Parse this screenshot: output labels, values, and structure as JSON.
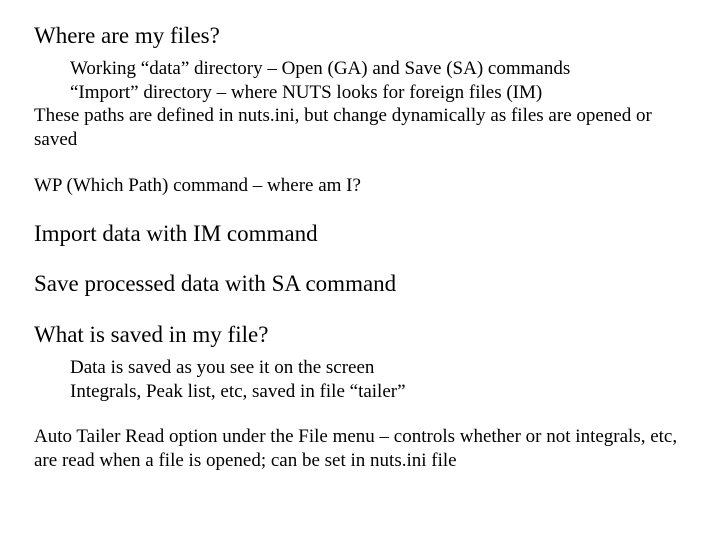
{
  "s1": {
    "heading": "Where are my files?",
    "sub1": "Working “data” directory – Open (GA) and Save (SA)  commands",
    "sub2": "“Import” directory – where NUTS looks for foreign files (IM)",
    "body1": "These paths are defined in nuts.ini, but change dynamically as files are opened or saved",
    "body2": "WP (Which Path) command – where am I?"
  },
  "s2": {
    "heading": "Import data with IM command"
  },
  "s3": {
    "heading": "Save processed data with SA command"
  },
  "s4": {
    "heading": "What is saved in my file?",
    "sub1": "Data is saved as you see it on the screen",
    "sub2": "Integrals, Peak list, etc, saved in file “tailer”",
    "body1": "Auto Tailer Read option under the File menu – controls whether or not integrals, etc, are read when a file is opened; can be set in nuts.ini file"
  }
}
